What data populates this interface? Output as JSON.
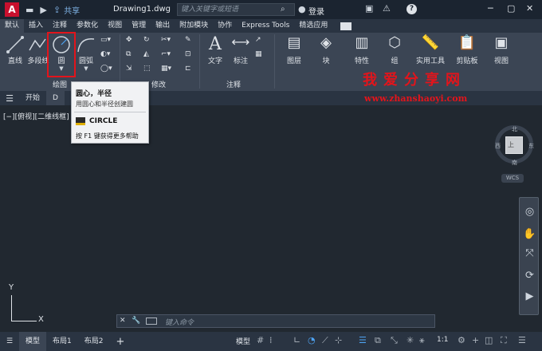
{
  "titlebar": {
    "logo": "A",
    "share": "共享",
    "doc_title": "Drawing1.dwg",
    "search_placeholder": "键入关键字或短语",
    "login": "登录",
    "help": "?",
    "icons": [
      "open-folder-icon",
      "save-icon",
      "share-icon",
      "search-icon",
      "user-icon",
      "cart-icon",
      "triangle-network-icon",
      "help-icon",
      "minimize-icon",
      "restore-icon",
      "close-icon"
    ]
  },
  "ribbon_tabs": [
    "默认",
    "插入",
    "注释",
    "参数化",
    "视图",
    "管理",
    "输出",
    "附加模块",
    "协作",
    "Express Tools",
    "精选应用"
  ],
  "ribbon": {
    "draw": {
      "line": "直线",
      "polyline": "多段线",
      "circle": "圆",
      "arc": "圆弧",
      "panel": "绘图"
    },
    "modify": {
      "panel": "修改"
    },
    "annotation": {
      "text": "文字",
      "dimension": "标注",
      "panel": "注释"
    },
    "layers": "图层",
    "block": "块",
    "properties": "特性",
    "groups": "组",
    "utilities": "实用工具",
    "clipboard": "剪贴板",
    "view": "视图"
  },
  "watermark": {
    "title": "我爱分享网",
    "url": "www.zhanshaoyi.com"
  },
  "file_tabs": {
    "start": "开始",
    "drawing": "D"
  },
  "canvas": {
    "viewport_label": "[−][俯视][二维线框]"
  },
  "tooltip": {
    "title": "圆心，半径",
    "desc": "用圆心和半径创建圆",
    "command": "CIRCLE",
    "help": "按 F1 键获得更多帮助"
  },
  "viewcube": {
    "top": "上",
    "north": "北",
    "south": "南",
    "east": "东",
    "west": "西",
    "wcs": "WCS"
  },
  "ucs": {
    "x": "X",
    "y": "Y"
  },
  "cmdline": {
    "placeholder": "键入命令"
  },
  "statusbar": {
    "tabs": [
      "模型",
      "布局1",
      "布局2"
    ],
    "add": "+",
    "model": "模型",
    "scale": "1:1"
  }
}
